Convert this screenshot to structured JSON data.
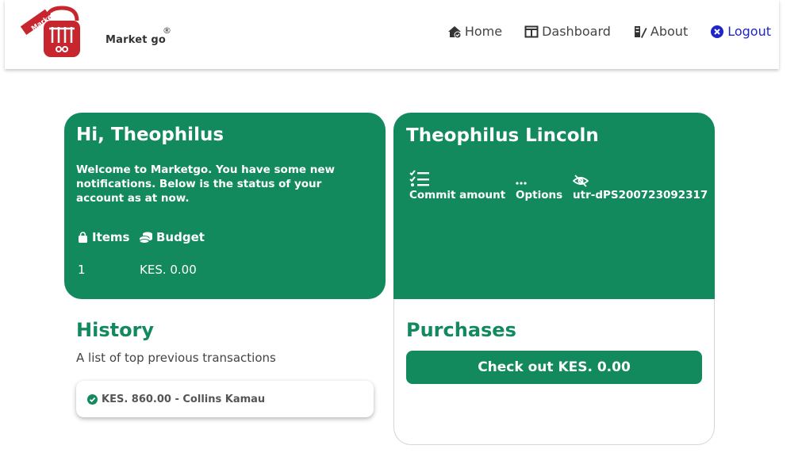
{
  "brand": {
    "name": "Market go",
    "tag_text": "Market",
    "registered": "®"
  },
  "nav": {
    "home": "Home",
    "dashboard": "Dashboard",
    "about": "About",
    "logout": "Logout"
  },
  "summary": {
    "greeting": "Hi, Theophilus",
    "welcome": "Welcome to Marketgo. You have some new notifications. Below is the status of your account as at now.",
    "items_label": "Items",
    "budget_label": "Budget",
    "items_value": "1",
    "budget_value": "KES. 0.00"
  },
  "profile": {
    "name": "Theophilus Lincoln",
    "commit_label": "Commit amount",
    "options_label": "Options",
    "reference": "utr-dPS200723092317"
  },
  "history": {
    "title": "History",
    "subtitle": "A list of top previous transactions",
    "transactions": [
      {
        "text": "KES. 860.00 - Collins Kamau"
      }
    ]
  },
  "purchases": {
    "title": "Purchases",
    "checkout_label": "Check out KES. 0.00"
  },
  "colors": {
    "brand_green": "#138a5e",
    "logo_red": "#c8262e",
    "logout_blue": "#1f26c9"
  }
}
